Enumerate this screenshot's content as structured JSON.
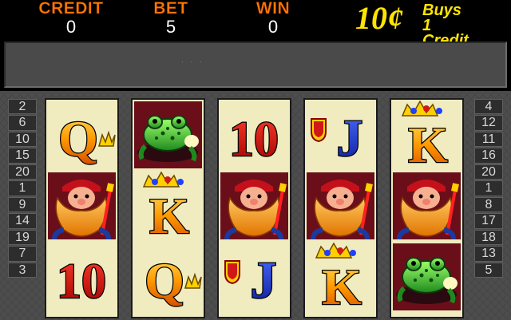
{
  "meters": {
    "credit": {
      "label": "CREDIT",
      "value": "0"
    },
    "bet": {
      "label": "BET",
      "value": "5"
    },
    "win": {
      "label": "WIN",
      "value": "0"
    }
  },
  "denomination": {
    "amount": "10¢",
    "text_line1": "Buys 1",
    "text_line2": "Credit"
  },
  "message_panel": {
    "text": "· · ·"
  },
  "paylines": {
    "left": [
      "2",
      "6",
      "10",
      "15",
      "20",
      "1",
      "9",
      "14",
      "19",
      "7",
      "3"
    ],
    "right": [
      "4",
      "12",
      "11",
      "16",
      "20",
      "1",
      "8",
      "17",
      "18",
      "13",
      "5"
    ]
  },
  "reels": [
    {
      "symbols": [
        {
          "name": "queen",
          "label": "Q"
        },
        {
          "name": "gnome",
          "label": ""
        },
        {
          "name": "ten",
          "label": "10"
        }
      ]
    },
    {
      "symbols": [
        {
          "name": "frog",
          "label": ""
        },
        {
          "name": "king",
          "label": "K"
        },
        {
          "name": "queen",
          "label": "Q"
        }
      ]
    },
    {
      "symbols": [
        {
          "name": "ten",
          "label": "10"
        },
        {
          "name": "gnome",
          "label": ""
        },
        {
          "name": "jack",
          "label": "J"
        }
      ]
    },
    {
      "symbols": [
        {
          "name": "jack",
          "label": "J"
        },
        {
          "name": "gnome",
          "label": ""
        },
        {
          "name": "king",
          "label": "K"
        }
      ]
    },
    {
      "symbols": [
        {
          "name": "king",
          "label": "K"
        },
        {
          "name": "gnome",
          "label": ""
        },
        {
          "name": "frog",
          "label": ""
        }
      ]
    }
  ],
  "colors": {
    "meter_label": "#ff7a00",
    "denom": "#ffe400",
    "reel_bg": "#f1ecc0",
    "cabinet": "#4d4d4d"
  }
}
